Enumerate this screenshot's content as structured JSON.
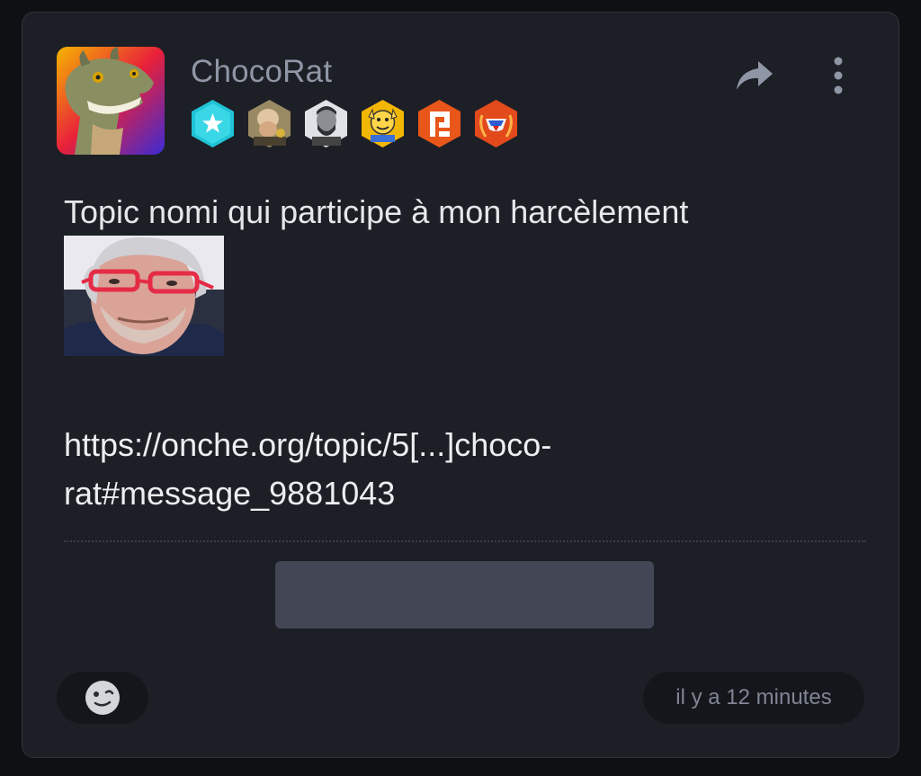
{
  "post": {
    "username": "ChocoRat",
    "message": "Topic nomi qui participe à mon harcèlement",
    "link_line1": "https://onche.org/topic/5[...]choco-",
    "link_line2": "rat#message_9881043",
    "timestamp": "il y a 12 minutes"
  },
  "icons": {
    "share": "share-arrow-icon",
    "more": "vertical-dots-icon",
    "reaction": "emoji-face-icon"
  },
  "colors": {
    "background": "#0f1013",
    "card": "#1d1f26",
    "username": "#8f96a6",
    "text": "#e6e7ea",
    "muted": "#7f8594",
    "pill": "#15161b",
    "placeholder": "#424655"
  }
}
